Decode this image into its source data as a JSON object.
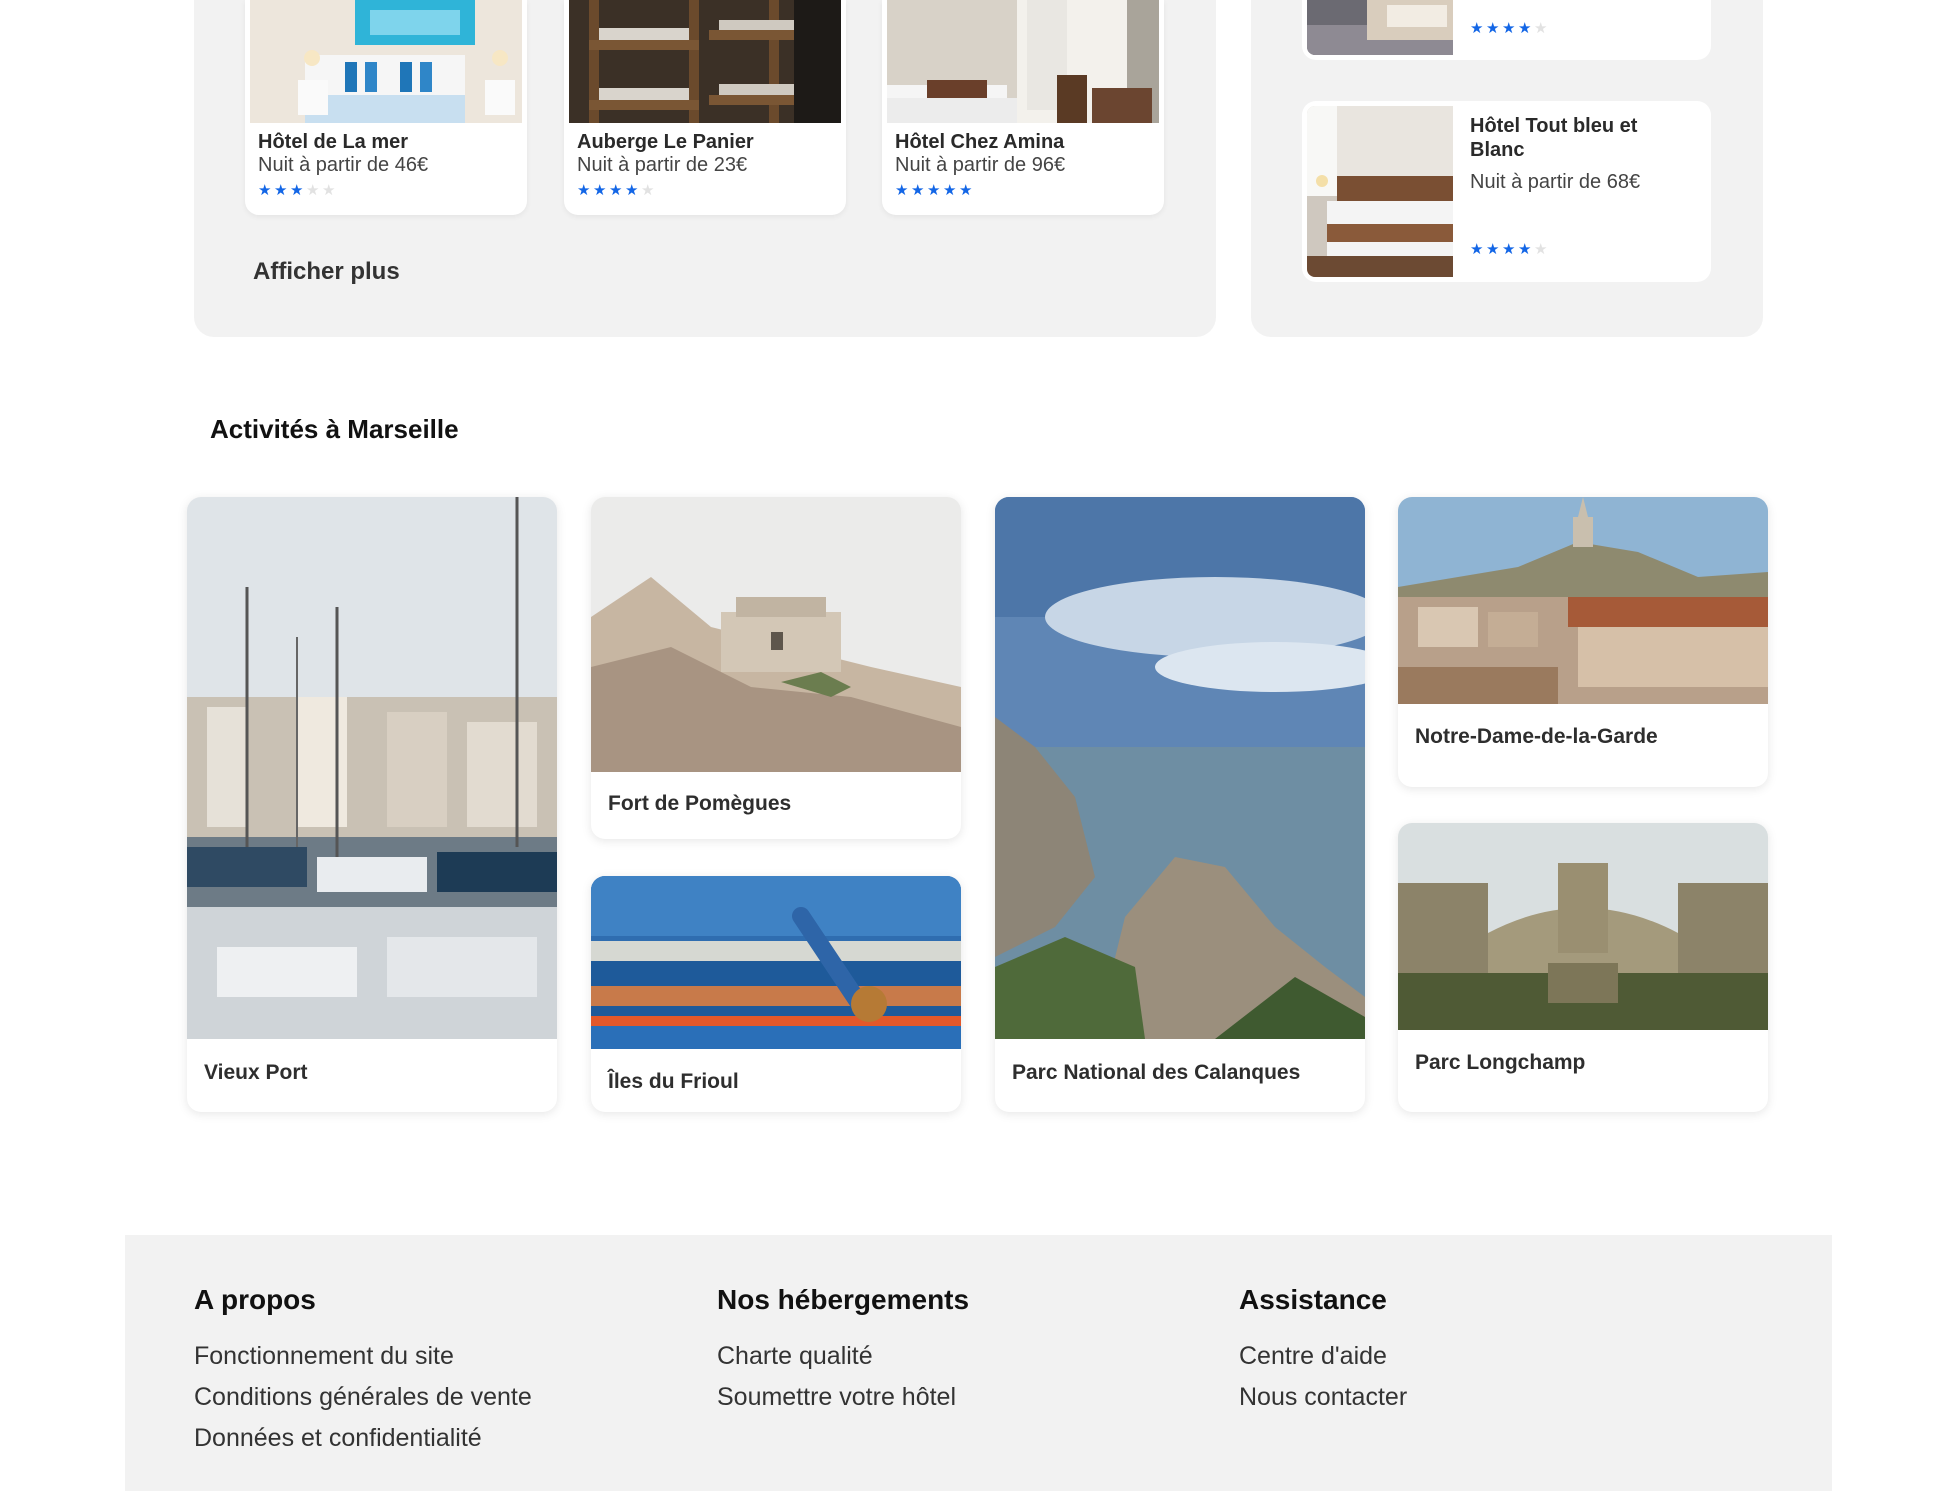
{
  "hotels": [
    {
      "name": "Hôtel de La mer",
      "price": "Nuit à partir de 46€",
      "rating": 3
    },
    {
      "name": "Auberge Le Panier",
      "price": "Nuit à partir de 23€",
      "rating": 4
    },
    {
      "name": "Hôtel Chez Amina",
      "price": "Nuit à partir de 96€",
      "rating": 5
    }
  ],
  "show_more": "Afficher plus",
  "side_hotels": [
    {
      "name": "",
      "price": "",
      "rating": 4
    },
    {
      "name": "Hôtel Tout bleu et Blanc",
      "price": "Nuit à partir de 68€",
      "rating": 4
    }
  ],
  "activities": {
    "title": "Activités à Marseille",
    "items": [
      {
        "label": "Vieux Port"
      },
      {
        "label": "Fort de Pomègues"
      },
      {
        "label": "Îles du Frioul"
      },
      {
        "label": "Parc National des Calanques"
      },
      {
        "label": "Notre-Dame-de-la-Garde"
      },
      {
        "label": "Parc Longchamp"
      }
    ]
  },
  "footer": {
    "about": {
      "title": "A propos",
      "links": [
        "Fonctionnement du site",
        "Conditions générales de vente",
        "Données et confidentialité"
      ]
    },
    "accommodations": {
      "title": "Nos hébergements",
      "links": [
        "Charte qualité",
        "Soumettre votre hôtel"
      ]
    },
    "support": {
      "title": "Assistance",
      "links": [
        "Centre d'aide",
        "Nous contacter"
      ]
    }
  },
  "colors": {
    "star_on": "#1366e6",
    "star_off": "#e2e2e2",
    "panel_bg": "#f2f2f2"
  },
  "icons": {
    "star": "star-icon"
  }
}
